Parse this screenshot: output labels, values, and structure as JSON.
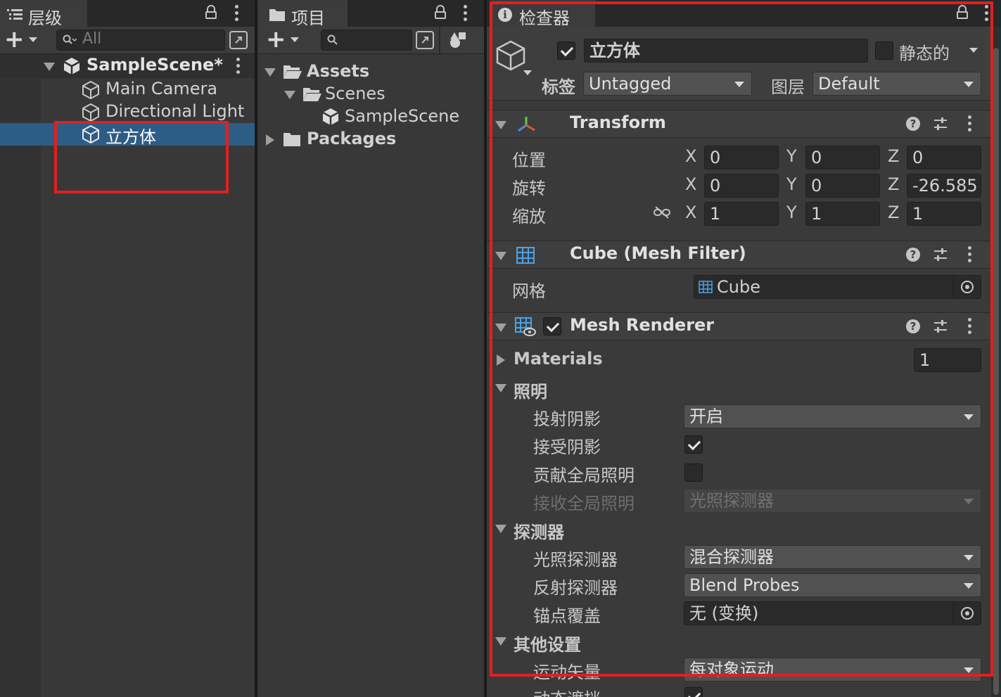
{
  "hierarchy": {
    "tab_label": "层级",
    "search_placeholder": "All",
    "scene_name": "SampleScene*",
    "items": [
      "Main Camera",
      "Directional Light",
      "立方体"
    ],
    "selected": "立方体"
  },
  "project": {
    "tab_label": "项目",
    "tree": {
      "assets": "Assets",
      "scenes": "Scenes",
      "sample_scene": "SampleScene",
      "packages": "Packages"
    }
  },
  "inspector": {
    "tab_label": "检查器",
    "object_name": "立方体",
    "active": true,
    "static_label": "静态的",
    "static": false,
    "tag_label": "标签",
    "tag_value": "Untagged",
    "layer_label": "图层",
    "layer_value": "Default",
    "transform": {
      "title": "Transform",
      "position_label": "位置",
      "rotation_label": "旋转",
      "scale_label": "缩放",
      "axes": [
        "X",
        "Y",
        "Z"
      ],
      "position": [
        "0",
        "0",
        "0"
      ],
      "rotation": [
        "0",
        "0",
        "-26.585"
      ],
      "scale": [
        "1",
        "1",
        "1"
      ]
    },
    "mesh_filter": {
      "title": "Cube (Mesh Filter)",
      "mesh_label": "网格",
      "mesh_value": "Cube"
    },
    "mesh_renderer": {
      "title": "Mesh Renderer",
      "enabled": true,
      "materials_label": "Materials",
      "materials_count": "1",
      "lighting_header": "照明",
      "cast_shadows_label": "投射阴影",
      "cast_shadows_value": "开启",
      "receive_shadows_label": "接受阴影",
      "receive_shadows": true,
      "contribute_gi_label": "贡献全局照明",
      "contribute_gi": false,
      "receive_gi_label": "接收全局照明",
      "receive_gi_value": "光照探测器",
      "probes_header": "探测器",
      "light_probes_label": "光照探测器",
      "light_probes_value": "混合探测器",
      "reflection_probes_label": "反射探测器",
      "reflection_probes_value": "Blend Probes",
      "anchor_override_label": "锚点覆盖",
      "anchor_override_value": "无 (变换)",
      "other_header": "其他设置",
      "motion_vectors_label": "运动矢量",
      "motion_vectors_value": "每对象运动",
      "dynamic_occlusion_label": "动态遮挡"
    }
  },
  "colors": {
    "selection": "#2c5d87",
    "highlight_box": "#e02020",
    "panel_bg": "#383838"
  }
}
